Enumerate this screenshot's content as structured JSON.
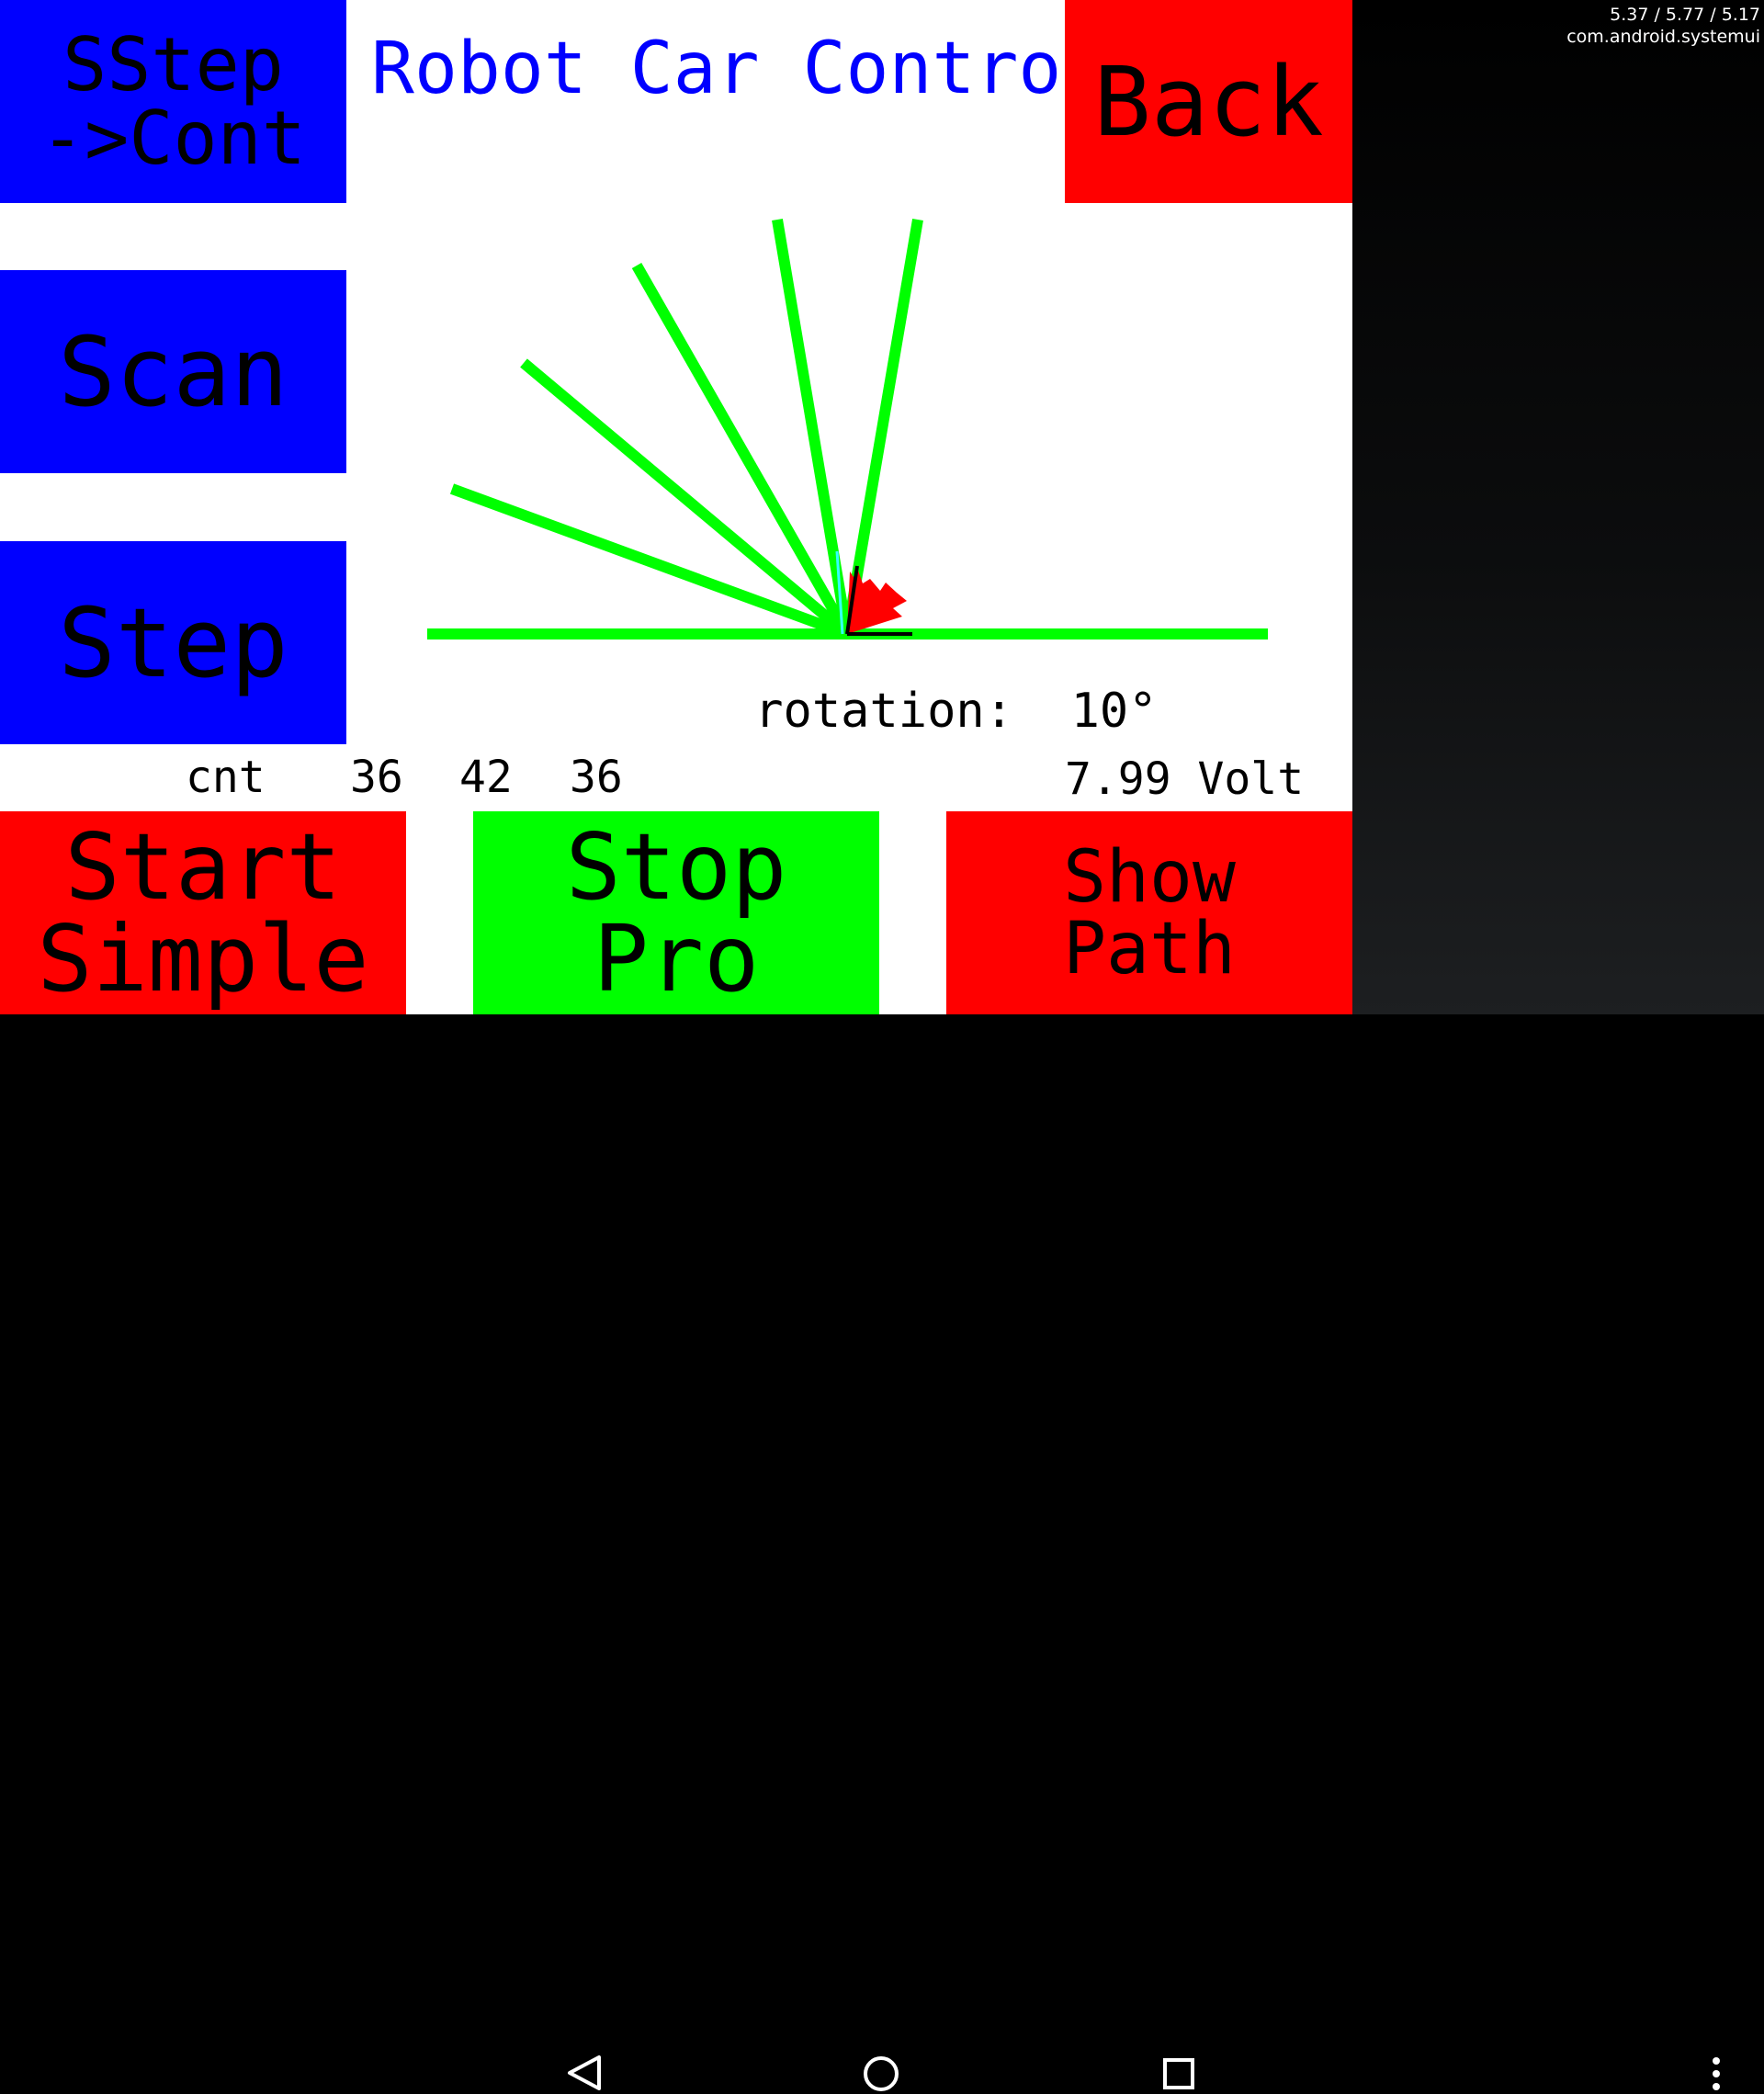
{
  "status": {
    "line1": "5.37 / 5.77 / 5.17",
    "line2": "com.android.systemui"
  },
  "title": "Robot Car Control",
  "buttons": {
    "sstep": [
      "SStep",
      "->Cont"
    ],
    "back": "Back",
    "scan": "Scan",
    "step": "Step",
    "start_simple": [
      "Start",
      "Simple"
    ],
    "stop_pro": [
      "Stop",
      "Pro"
    ],
    "show_path": [
      "Show",
      "Path"
    ]
  },
  "rotation": {
    "label": "rotation:",
    "value": "10°"
  },
  "counts": {
    "label": "cnt",
    "values": [
      "36",
      "42",
      "36"
    ]
  },
  "voltage": "7.99 Volt",
  "colors": {
    "blue_button": "#0000ff",
    "red_button": "#ff0000",
    "green_button": "#00ff00",
    "scan_line": "#00ff00",
    "car_marker": "#ff0000",
    "title_text": "#0000ff"
  },
  "nav_icons": [
    "back-icon",
    "home-icon",
    "recents-icon",
    "overflow-menu-icon"
  ]
}
